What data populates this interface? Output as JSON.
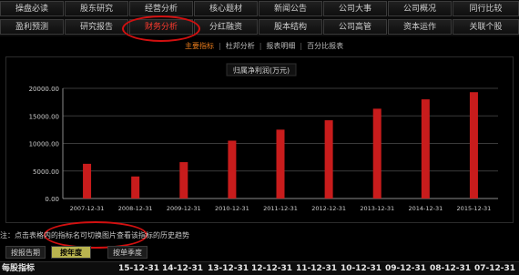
{
  "nav": {
    "row1": [
      "操盘必读",
      "股东研究",
      "经营分析",
      "核心题材",
      "新闻公告",
      "公司大事",
      "公司概况",
      "同行比较"
    ],
    "row2": [
      "盈利预测",
      "研究报告",
      "财务分析",
      "分红融资",
      "股本结构",
      "公司高管",
      "资本运作",
      "关联个股"
    ],
    "active": "财务分析"
  },
  "subtabs": {
    "items": [
      "主要指标",
      "杜邦分析",
      "报表明细",
      "百分比报表"
    ],
    "active": "主要指标"
  },
  "chart_data": {
    "type": "bar",
    "title": "归属净利润(万元)",
    "categories": [
      "2007-12-31",
      "2008-12-31",
      "2009-12-31",
      "2010-12-31",
      "2011-12-31",
      "2012-12-31",
      "2013-12-31",
      "2014-12-31",
      "2015-12-31"
    ],
    "values": [
      6300,
      4000,
      6600,
      10500,
      12500,
      14200,
      16300,
      18000,
      19300
    ],
    "ylim": [
      0,
      20000
    ],
    "yticks": [
      "0.00",
      "5000.00",
      "10000.00",
      "15000.00",
      "20000.00"
    ],
    "grid": true,
    "bar_color": "#c81c1c"
  },
  "note": "注：点击表格内的指标名可切换图片查看该指标的历史趋势",
  "mode_tabs": {
    "items": [
      "按报告期",
      "按年度",
      "按单季度"
    ],
    "active": "按年度"
  },
  "table_header": {
    "label": "每股指标",
    "dates": [
      "15-12-31",
      "14-12-31",
      "13-12-31",
      "12-12-31",
      "11-12-31",
      "10-12-31",
      "09-12-31",
      "08-12-31",
      "07-12-31"
    ]
  },
  "colors": {
    "accent_active_tab": "#ff3b2f",
    "highlight_circle": "#d21010",
    "subtab_active": "#e87b1c",
    "mode_active_bg": "#b9b44f"
  }
}
